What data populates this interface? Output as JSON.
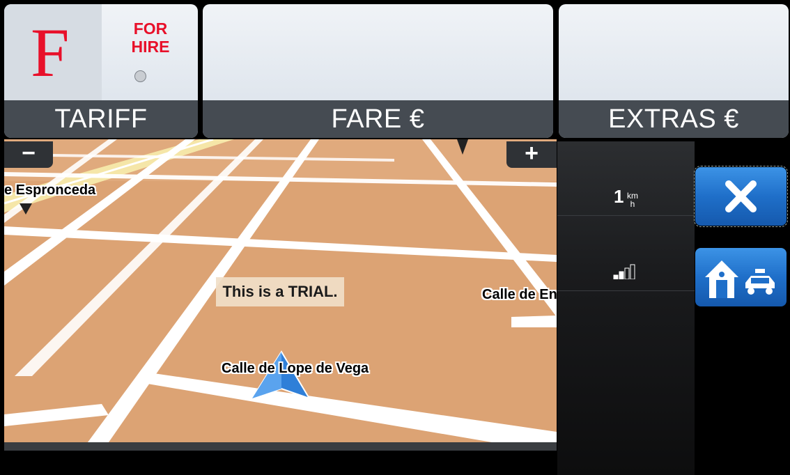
{
  "panels": {
    "tariff": {
      "caption": "TARIFF",
      "letter": "F",
      "status_lines": [
        "FOR",
        "HIRE"
      ]
    },
    "fare": {
      "caption": "FARE €"
    },
    "extras": {
      "caption": "EXTRAS €"
    }
  },
  "map": {
    "zoom_out_label": "−",
    "zoom_in_label": "+",
    "streets": {
      "left": "e Espronceda",
      "right": "Calle de En",
      "current": "Calle de Lope de Vega"
    },
    "trial_notice": "This is a TRIAL."
  },
  "info": {
    "speed_value": "1",
    "speed_unit_top": "km",
    "speed_unit_bottom": "h",
    "signal_strength_bars": 2,
    "signal_total_bars": 4
  },
  "colors": {
    "tariff_red": "#e8102a",
    "button_blue": "#1f6fc9",
    "map_ground": "#dca374",
    "caption_bg": "#454b52"
  },
  "icons": {
    "close": "close-icon",
    "home_taxi": "home-taxi-icon",
    "position": "navigation-arrow-icon",
    "signal": "signal-strength-icon"
  }
}
